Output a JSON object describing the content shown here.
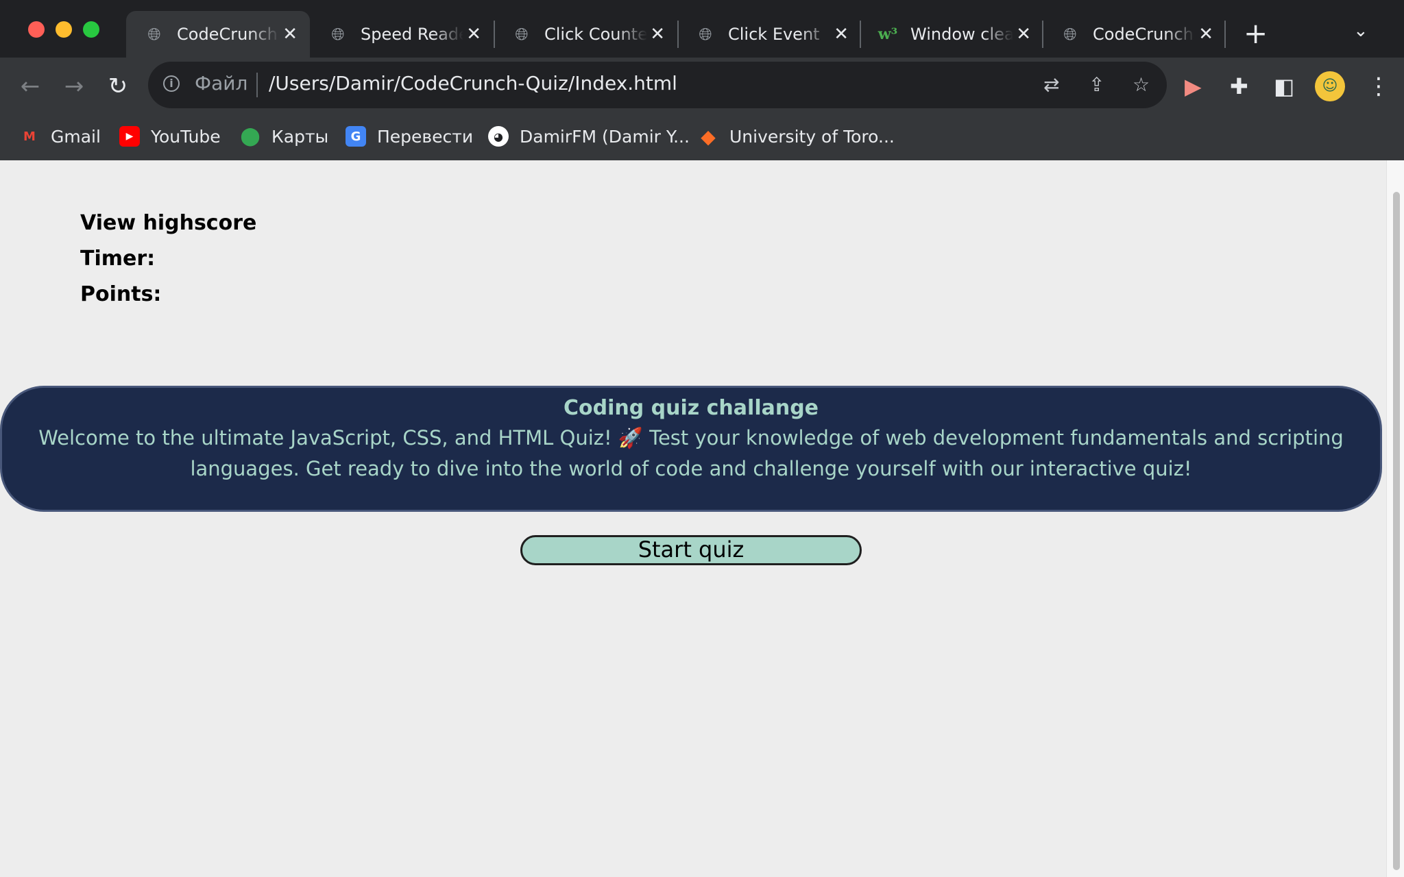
{
  "browser": {
    "tabs": [
      {
        "title": "CodeCrunch Quiz",
        "favicon": "globe-icon",
        "active": true
      },
      {
        "title": "Speed Reader",
        "favicon": "globe-icon",
        "active": false
      },
      {
        "title": "Click Counter",
        "favicon": "globe-icon",
        "active": false
      },
      {
        "title": "Click Event",
        "favicon": "globe-icon",
        "active": false
      },
      {
        "title": "Window clearInterval",
        "favicon": "w3schools-icon",
        "active": false
      },
      {
        "title": "CodeCrunch Quiz",
        "favicon": "globe-icon",
        "active": false
      }
    ],
    "new_tab_symbol": "+",
    "close_symbol": "✕",
    "address": {
      "scheme_label": "Файл",
      "url": "/Users/Damir/CodeCrunch-Quiz/Index.html"
    },
    "bookmarks": [
      {
        "label": "Gmail",
        "icon": "gmail-icon",
        "color": "#ea4335"
      },
      {
        "label": "YouTube",
        "icon": "youtube-icon",
        "color": "#ff0000"
      },
      {
        "label": "Карты",
        "icon": "maps-pin-icon",
        "color": "#34a853"
      },
      {
        "label": "Перевести",
        "icon": "google-translate-icon",
        "color": "#4285f4"
      },
      {
        "label": "DamirFM (Damir Y...",
        "icon": "github-icon",
        "color": "#ffffff"
      },
      {
        "label": "University of Toro...",
        "icon": "gitlab-icon",
        "color": "#fc6d26"
      }
    ]
  },
  "page": {
    "highscore_link": "View highscore",
    "timer_label": "Timer:",
    "points_label": "Points:",
    "banner": {
      "title": "Coding quiz challange",
      "text": "Welcome to the ultimate JavaScript, CSS, and HTML Quiz! 🚀 Test your knowledge of web development fundamentals and scripting languages. Get ready to dive into the world of code and challenge yourself with our interactive quiz!"
    },
    "start_button": "Start quiz"
  },
  "colors": {
    "banner_bg": "#1c2a4a",
    "banner_text": "#a8d5c8",
    "button_bg": "#a8d5c8",
    "page_bg": "#ededed"
  }
}
